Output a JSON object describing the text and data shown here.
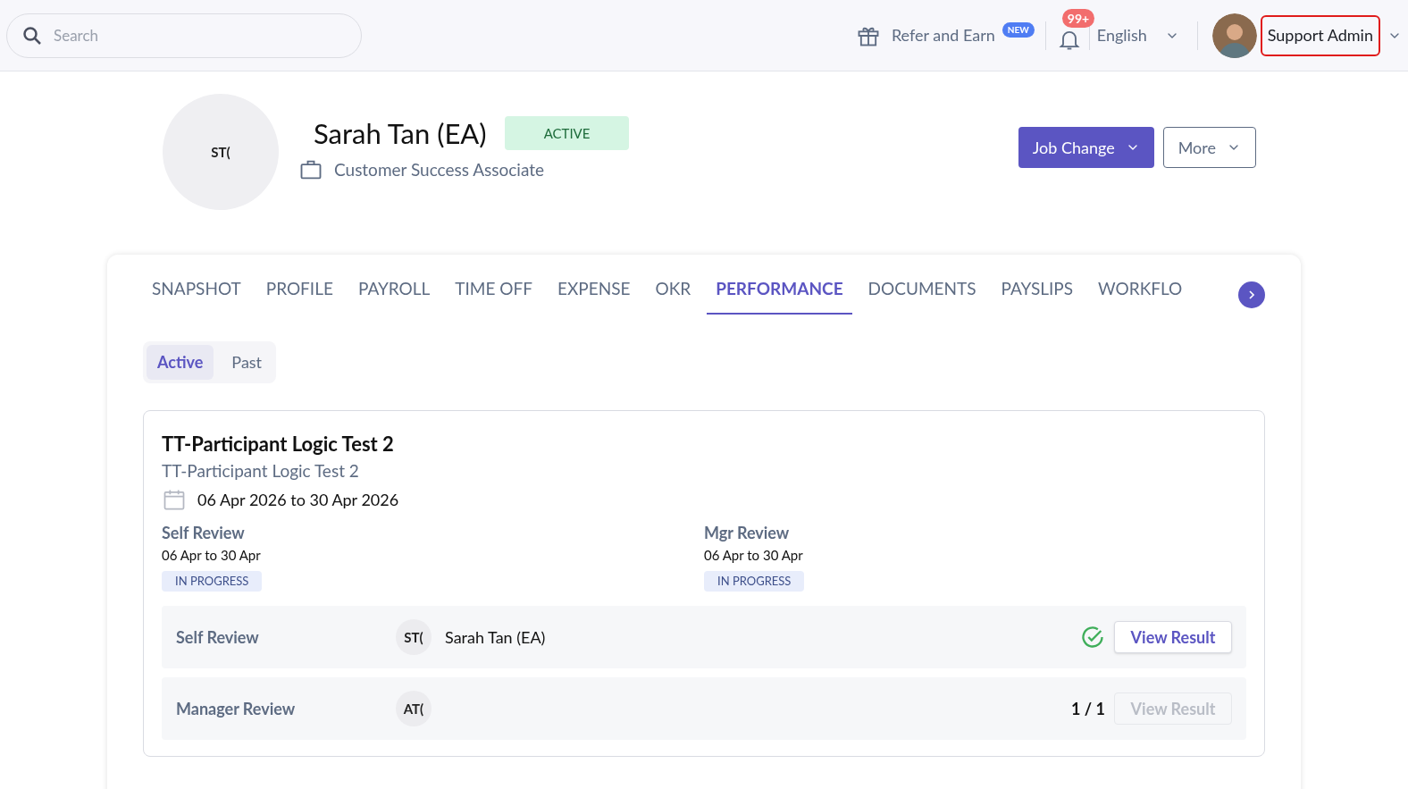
{
  "topbar": {
    "search": {
      "placeholder": "Search"
    },
    "refer": {
      "label": "Refer and Earn",
      "badge": "NEW"
    },
    "notifications": {
      "count": "99+"
    },
    "language": "English",
    "user": {
      "name": "Support Admin",
      "highlighted": true
    }
  },
  "profile": {
    "initials": "ST(",
    "name": "Sarah Tan (EA)",
    "status": "ACTIVE",
    "job_title": "Customer Success Associate",
    "buttons": [
      {
        "label": "Job Change",
        "kind": "primary"
      },
      {
        "label": "More",
        "kind": "outline"
      }
    ]
  },
  "tabs": [
    {
      "label": "SNAPSHOT",
      "selected": false
    },
    {
      "label": "PROFILE",
      "selected": false
    },
    {
      "label": "PAYROLL",
      "selected": false
    },
    {
      "label": "TIME OFF",
      "selected": false
    },
    {
      "label": "EXPENSE",
      "selected": false
    },
    {
      "label": "OKR",
      "selected": false
    },
    {
      "label": "PERFORMANCE",
      "selected": true
    },
    {
      "label": "DOCUMENTS",
      "selected": false
    },
    {
      "label": "PAYSLIPS",
      "selected": false
    },
    {
      "label": "WORKFLO",
      "selected": false
    }
  ],
  "segments": [
    {
      "label": "Active",
      "selected": true
    },
    {
      "label": "Past",
      "selected": false
    }
  ],
  "review_card": {
    "title": "TT-Participant Logic Test 2",
    "subtitle": "TT-Participant Logic Test 2",
    "dates": "06 Apr 2026 to 30 Apr 2026",
    "stages": [
      {
        "name": "Self Review",
        "dates": "06 Apr to 30 Apr",
        "status": "IN PROGRESS"
      },
      {
        "name": "Mgr Review",
        "dates": "06 Apr to 30 Apr",
        "status": "IN PROGRESS"
      }
    ],
    "rows": [
      {
        "label": "Self Review",
        "initials": "ST(",
        "reviewer": "Sarah Tan (EA)",
        "kind": "completed",
        "action": "View Result",
        "disabled": false
      },
      {
        "label": "Manager Review",
        "initials": "AT(",
        "kind": "count",
        "count": "1 / 1",
        "action": "View Result",
        "disabled": true
      }
    ]
  }
}
